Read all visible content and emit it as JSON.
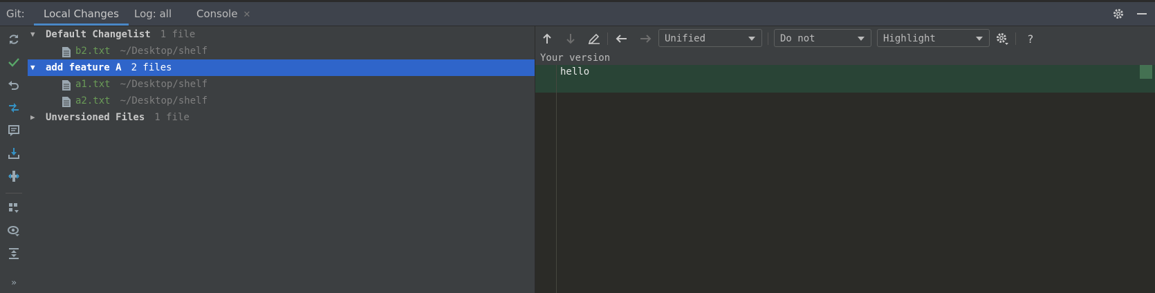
{
  "tabbar": {
    "prefix": "Git:",
    "tabs": [
      {
        "label": "Local Changes",
        "active": true
      },
      {
        "label": "Log: all",
        "active": false
      },
      {
        "label": "Console",
        "active": false,
        "closable": true
      }
    ],
    "right_icons": [
      "gear-icon",
      "minimize-icon"
    ]
  },
  "left_toolbar": {
    "icons": [
      "refresh-icon",
      "commit-check-icon",
      "rollback-icon",
      "compare-icon",
      "changelist-icon",
      "shelve-icon",
      "unshelve-icon",
      "group-by-icon",
      "view-options-icon",
      "expand-all-icon",
      "more-icon"
    ]
  },
  "tree": {
    "changelists": [
      {
        "name": "Default Changelist",
        "count": "1 file",
        "expanded": true,
        "selected": false,
        "files": [
          {
            "name": "b2.txt",
            "path": "~/Desktop/shelf"
          }
        ]
      },
      {
        "name": "add feature A",
        "count": "2 files",
        "expanded": true,
        "selected": true,
        "files": [
          {
            "name": "a1.txt",
            "path": "~/Desktop/shelf"
          },
          {
            "name": "a2.txt",
            "path": "~/Desktop/shelf"
          }
        ]
      },
      {
        "name": "Unversioned Files",
        "count": "1 file",
        "expanded": false,
        "selected": false,
        "files": []
      }
    ]
  },
  "diff": {
    "toolbar": {
      "viewer": "Unified viewer",
      "ignore": "Do not ignore",
      "highlight": "Highlight words",
      "help": "?"
    },
    "version_label": "Your version",
    "lines": [
      "hello"
    ]
  },
  "colors": {
    "selection": "#2f65ca",
    "added_line": "#294436",
    "file_added": "#6a9b57",
    "accent_tab": "#4a88c7"
  }
}
